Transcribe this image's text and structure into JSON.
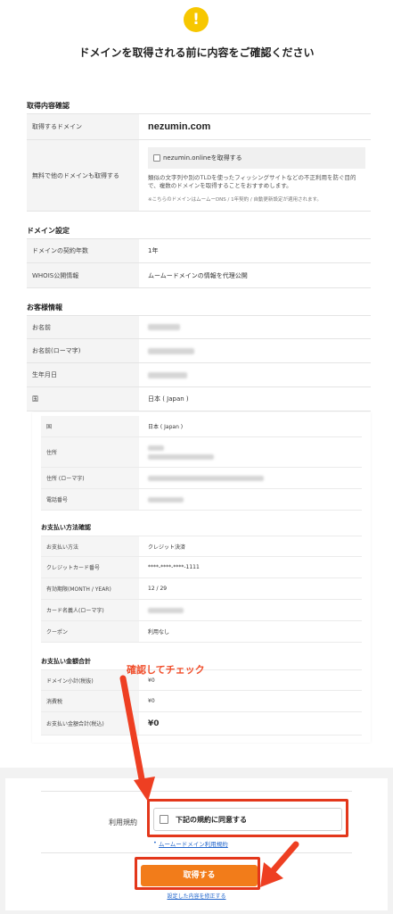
{
  "page": {
    "title": "ドメインを取得される前に内容をご確認ください",
    "alert_glyph": "!"
  },
  "acquisition": {
    "heading": "取得内容確認",
    "domain_label": "取得するドメイン",
    "domain_value": "nezumin.com",
    "free_label": "無料で他のドメインも取得する",
    "free_option": "nezumin.onlineを取得する",
    "free_desc": "類似の文字列や別のTLDを使ったフィッシングサイトなどの不正利用を防ぐ目的で、複数のドメインを取得することをおすすめします。",
    "free_note": "※こちらのドメインはムームーDNS / 1年契約 / 自動更新設定が適用されます。"
  },
  "domain_settings": {
    "heading": "ドメイン設定",
    "term_label": "ドメインの契約年数",
    "term_value": "1年",
    "whois_label": "WHOIS公開情報",
    "whois_value": "ムームードメインの情報を代理公開"
  },
  "customer": {
    "heading": "お客様情報",
    "name_label": "お名前",
    "name_roman_label": "お名前(ローマ字)",
    "birth_label": "生年月日",
    "country_label": "国",
    "country_value": "日本 ( Japan )"
  },
  "inner": {
    "country_label": "国",
    "country_value": "日本 ( Japan )",
    "address_label": "住所",
    "address_roman_label": "住所 (ローマ字)",
    "phone_label": "電話番号",
    "payment_heading": "お支払い方法確認",
    "method_label": "お支払い方法",
    "method_value": "クレジット決済",
    "card_label": "クレジットカード番号",
    "card_value": "****-****-****-1111",
    "expiry_label": "有効期限(MONTH / YEAR)",
    "expiry_value": "12 / 29",
    "holder_label": "カード名義人(ローマ字)",
    "coupon_label": "クーポン",
    "coupon_value": "利用なし",
    "total_heading": "お支払い金額合計",
    "subtotal_label": "ドメイン小計(税抜)",
    "subtotal_value": "¥0",
    "tax_label": "消費税",
    "tax_value": "¥0",
    "total_label": "お支払い金額合計(税込)",
    "total_value": "¥0"
  },
  "annotation": {
    "text": "確認してチェック",
    "color": "#f04d2a"
  },
  "terms": {
    "label": "利用規約",
    "agree": "下記の規約に同意する",
    "link": "ムームードメイン利用規約",
    "submit": "取得する",
    "edit": "設定した内容を修正する"
  },
  "colors": {
    "accent": "#f27c1a",
    "highlight": "#e3371b",
    "alert": "#f7c700"
  }
}
